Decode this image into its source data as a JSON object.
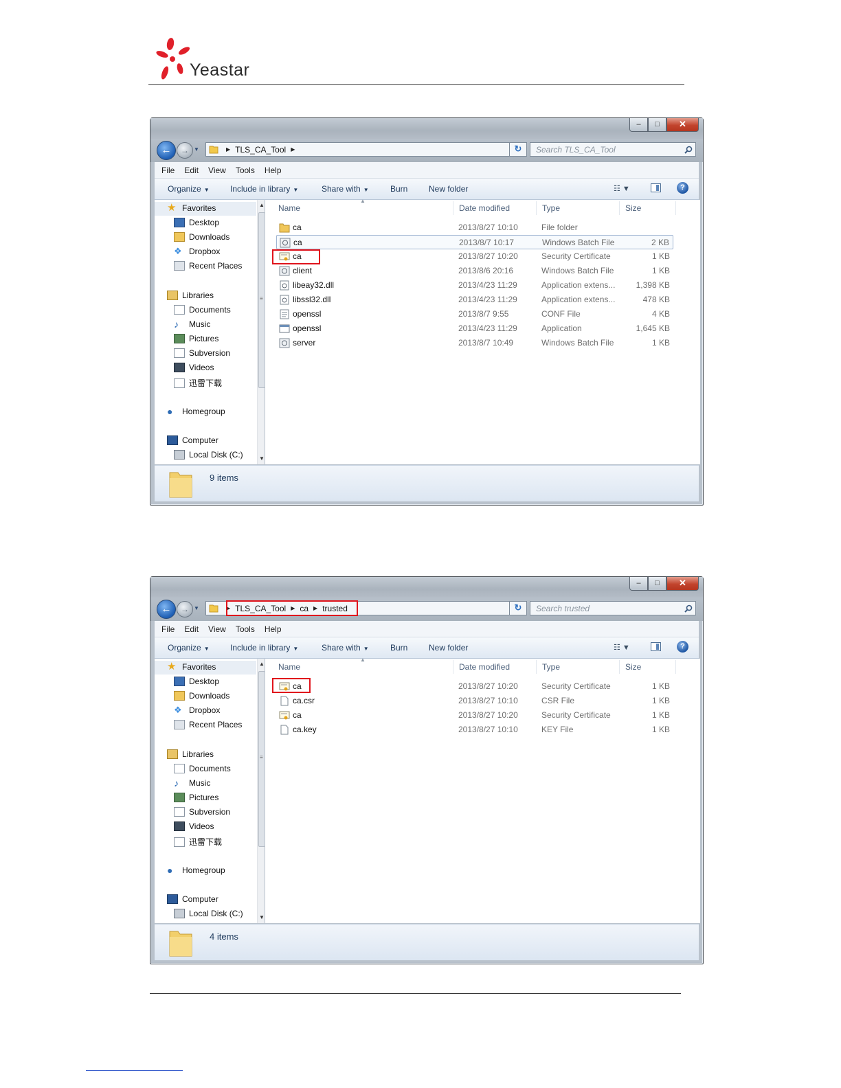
{
  "header": {
    "logo_text": "Yeastar"
  },
  "windows": [
    {
      "window_controls": {
        "minimize": "–",
        "maximize": "□",
        "close": "✕"
      },
      "breadcrumb": [
        "TLS_CA_Tool"
      ],
      "search_placeholder": "Search TLS_CA_Tool",
      "menu": [
        "File",
        "Edit",
        "View",
        "Tools",
        "Help"
      ],
      "commands": {
        "organize": "Organize",
        "include_in_library": "Include in library",
        "share_with": "Share with",
        "burn": "Burn",
        "new_folder": "New folder"
      },
      "nav": {
        "favorites": "Favorites",
        "favorites_items": [
          "Desktop",
          "Downloads",
          "Dropbox",
          "Recent Places"
        ],
        "libraries": "Libraries",
        "libraries_items": [
          "Documents",
          "Music",
          "Pictures",
          "Subversion",
          "Videos",
          "迅雷下载"
        ],
        "homegroup": "Homegroup",
        "computer": "Computer",
        "computer_items": [
          "Local Disk (C:)"
        ]
      },
      "columns": {
        "name": "Name",
        "date": "Date modified",
        "type": "Type",
        "size": "Size"
      },
      "files": [
        {
          "name": "ca",
          "date": "2013/8/27 10:10",
          "type": "File folder",
          "size": "",
          "icon": "folder-icon"
        },
        {
          "name": "ca",
          "date": "2013/8/7 10:17",
          "type": "Windows Batch File",
          "size": "2 KB",
          "icon": "batch-file-icon"
        },
        {
          "name": "ca",
          "date": "2013/8/27 10:20",
          "type": "Security Certificate",
          "size": "1 KB",
          "icon": "certificate-icon"
        },
        {
          "name": "client",
          "date": "2013/8/6 20:16",
          "type": "Windows Batch File",
          "size": "1 KB",
          "icon": "batch-file-icon"
        },
        {
          "name": "libeay32.dll",
          "date": "2013/4/23 11:29",
          "type": "Application extens...",
          "size": "1,398 KB",
          "icon": "dll-icon"
        },
        {
          "name": "libssl32.dll",
          "date": "2013/4/23 11:29",
          "type": "Application extens...",
          "size": "478 KB",
          "icon": "dll-icon"
        },
        {
          "name": "openssl",
          "date": "2013/8/7 9:55",
          "type": "CONF File",
          "size": "4 KB",
          "icon": "conf-file-icon"
        },
        {
          "name": "openssl",
          "date": "2013/4/23 11:29",
          "type": "Application",
          "size": "1,645 KB",
          "icon": "application-icon"
        },
        {
          "name": "server",
          "date": "2013/8/7 10:49",
          "type": "Windows Batch File",
          "size": "1 KB",
          "icon": "batch-file-icon"
        }
      ],
      "status": "9 items"
    },
    {
      "window_controls": {
        "minimize": "–",
        "maximize": "□",
        "close": "✕"
      },
      "breadcrumb": [
        "TLS_CA_Tool",
        "ca",
        "trusted"
      ],
      "search_placeholder": "Search trusted",
      "menu": [
        "File",
        "Edit",
        "View",
        "Tools",
        "Help"
      ],
      "commands": {
        "organize": "Organize",
        "include_in_library": "Include in library",
        "share_with": "Share with",
        "burn": "Burn",
        "new_folder": "New folder"
      },
      "nav": {
        "favorites": "Favorites",
        "favorites_items": [
          "Desktop",
          "Downloads",
          "Dropbox",
          "Recent Places"
        ],
        "libraries": "Libraries",
        "libraries_items": [
          "Documents",
          "Music",
          "Pictures",
          "Subversion",
          "Videos",
          "迅雷下载"
        ],
        "homegroup": "Homegroup",
        "computer": "Computer",
        "computer_items": [
          "Local Disk (C:)"
        ]
      },
      "columns": {
        "name": "Name",
        "date": "Date modified",
        "type": "Type",
        "size": "Size"
      },
      "files": [
        {
          "name": "ca",
          "date": "2013/8/27 10:20",
          "type": "Security Certificate",
          "size": "1 KB",
          "icon": "certificate-icon"
        },
        {
          "name": "ca.csr",
          "date": "2013/8/27 10:10",
          "type": "CSR File",
          "size": "1 KB",
          "icon": "blank-file-icon"
        },
        {
          "name": "ca",
          "date": "2013/8/27 10:20",
          "type": "Security Certificate",
          "size": "1 KB",
          "icon": "certificate-icon"
        },
        {
          "name": "ca.key",
          "date": "2013/8/27 10:10",
          "type": "KEY File",
          "size": "1 KB",
          "icon": "blank-file-icon"
        }
      ],
      "status": "4 items"
    }
  ]
}
